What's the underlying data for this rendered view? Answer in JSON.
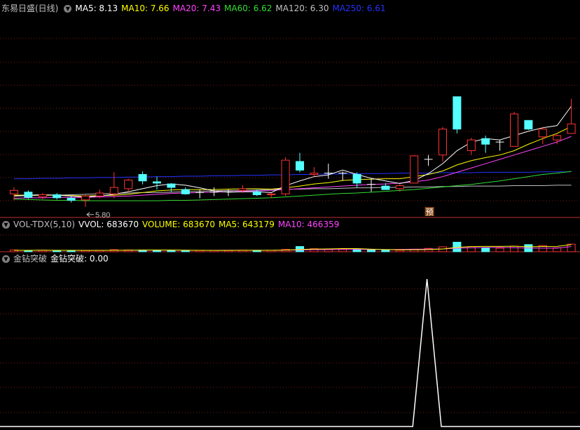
{
  "main_header": {
    "title": "东易日盛(日线)",
    "items": [
      {
        "label": "MA5: 8.13",
        "color": "#ffffff"
      },
      {
        "label": "MA10: 7.66",
        "color": "#ffff00"
      },
      {
        "label": "MA20: 7.43",
        "color": "#ff44ff"
      },
      {
        "label": "MA60: 6.62",
        "color": "#33dd33"
      },
      {
        "label": "MA120: 6.30",
        "color": "#c0c0c0"
      },
      {
        "label": "MA250: 6.61",
        "color": "#2233ff"
      }
    ]
  },
  "vol_header": {
    "title": "VOL-TDX(5,10)",
    "items": [
      {
        "label": "VVOL: 683670",
        "color": "#ffffff"
      },
      {
        "label": "VOLUME: 683670",
        "color": "#ffff00"
      },
      {
        "label": "MA5: 643179",
        "color": "#ffff00"
      },
      {
        "label": "MA10: 466359",
        "color": "#ff44ff"
      }
    ]
  },
  "ind_header": {
    "title": "金钻突破",
    "items": [
      {
        "label": "金钻突破: 0.00",
        "color": "#ffffff"
      }
    ]
  },
  "annotations": {
    "low_marker": "5.80",
    "forecast_tag": "预"
  },
  "colors": {
    "up": "#ff3333",
    "down": "#54ffff",
    "grid": "#7a1a1a",
    "frame": "#c03030"
  },
  "chart_data": [
    {
      "type": "candlestick",
      "title": "东易日盛(日线)",
      "candles": [
        {
          "o": 6.1,
          "h": 6.25,
          "l": 5.95,
          "c": 6.18
        },
        {
          "o": 6.14,
          "h": 6.18,
          "l": 5.98,
          "c": 6.02
        },
        {
          "o": 6.03,
          "h": 6.12,
          "l": 5.98,
          "c": 6.08
        },
        {
          "o": 6.08,
          "h": 6.12,
          "l": 5.97,
          "c": 6.01
        },
        {
          "o": 6.0,
          "h": 6.04,
          "l": 5.9,
          "c": 5.95
        },
        {
          "o": 5.96,
          "h": 6.08,
          "l": 5.8,
          "c": 6.05
        },
        {
          "o": 6.05,
          "h": 6.2,
          "l": 6.0,
          "c": 6.12
        },
        {
          "o": 6.1,
          "h": 6.6,
          "l": 6.0,
          "c": 6.25
        },
        {
          "o": 6.22,
          "h": 6.45,
          "l": 6.15,
          "c": 6.42
        },
        {
          "o": 6.55,
          "h": 6.62,
          "l": 6.32,
          "c": 6.4
        },
        {
          "o": 6.38,
          "h": 6.5,
          "l": 6.2,
          "c": 6.35
        },
        {
          "o": 6.33,
          "h": 6.35,
          "l": 6.15,
          "c": 6.25
        },
        {
          "o": 6.2,
          "h": 6.25,
          "l": 6.08,
          "c": 6.1
        },
        {
          "o": 6.12,
          "h": 6.2,
          "l": 6.0,
          "c": 6.13
        },
        {
          "o": 6.14,
          "h": 6.25,
          "l": 6.05,
          "c": 6.14
        },
        {
          "o": 6.15,
          "h": 6.2,
          "l": 6.05,
          "c": 6.15
        },
        {
          "o": 6.18,
          "h": 6.3,
          "l": 6.12,
          "c": 6.22
        },
        {
          "o": 6.15,
          "h": 6.2,
          "l": 6.05,
          "c": 6.08
        },
        {
          "o": 6.08,
          "h": 6.12,
          "l": 6.0,
          "c": 6.1
        },
        {
          "o": 6.1,
          "h": 6.95,
          "l": 6.05,
          "c": 6.88
        },
        {
          "o": 6.85,
          "h": 7.05,
          "l": 6.6,
          "c": 6.65
        },
        {
          "o": 6.55,
          "h": 6.72,
          "l": 6.5,
          "c": 6.58
        },
        {
          "o": 6.58,
          "h": 6.8,
          "l": 6.45,
          "c": 6.58
        },
        {
          "o": 6.58,
          "h": 6.62,
          "l": 6.4,
          "c": 6.58
        },
        {
          "o": 6.55,
          "h": 6.6,
          "l": 6.25,
          "c": 6.35
        },
        {
          "o": 6.33,
          "h": 6.45,
          "l": 6.15,
          "c": 6.32
        },
        {
          "o": 6.28,
          "h": 6.35,
          "l": 6.2,
          "c": 6.2
        },
        {
          "o": 6.22,
          "h": 6.32,
          "l": 6.15,
          "c": 6.29
        },
        {
          "o": 6.35,
          "h": 7.0,
          "l": 6.35,
          "c": 6.98
        },
        {
          "o": 6.9,
          "h": 7.0,
          "l": 6.75,
          "c": 6.9
        },
        {
          "o": 7.0,
          "h": 7.65,
          "l": 6.85,
          "c": 7.6
        },
        {
          "o": 8.35,
          "h": 8.35,
          "l": 7.5,
          "c": 7.6
        },
        {
          "o": 7.1,
          "h": 7.4,
          "l": 7.0,
          "c": 7.35
        },
        {
          "o": 7.38,
          "h": 7.45,
          "l": 7.05,
          "c": 7.25
        },
        {
          "o": 7.3,
          "h": 7.35,
          "l": 7.1,
          "c": 7.3
        },
        {
          "o": 7.2,
          "h": 8.0,
          "l": 7.2,
          "c": 7.95
        },
        {
          "o": 7.8,
          "h": 7.8,
          "l": 7.58,
          "c": 7.6
        },
        {
          "o": 7.42,
          "h": 7.65,
          "l": 7.25,
          "c": 7.6
        },
        {
          "o": 7.35,
          "h": 7.48,
          "l": 7.25,
          "c": 7.45
        },
        {
          "o": 7.5,
          "h": 8.3,
          "l": 7.5,
          "c": 7.72
        }
      ],
      "ma": {
        "MA5": [
          6.05,
          6.07,
          6.08,
          6.07,
          6.05,
          6.03,
          6.05,
          6.09,
          6.15,
          6.22,
          6.29,
          6.33,
          6.3,
          6.24,
          6.17,
          6.14,
          6.15,
          6.15,
          6.13,
          6.29,
          6.4,
          6.5,
          6.54,
          6.65,
          6.55,
          6.46,
          6.4,
          6.34,
          6.41,
          6.57,
          6.8,
          7.1,
          7.3,
          7.38,
          7.35,
          7.45,
          7.55,
          7.63,
          7.68,
          8.13
        ],
        "MA10": [
          6.07,
          6.07,
          6.07,
          6.07,
          6.06,
          6.05,
          6.06,
          6.07,
          6.09,
          6.13,
          6.17,
          6.19,
          6.2,
          6.2,
          6.2,
          6.21,
          6.22,
          6.22,
          6.21,
          6.24,
          6.28,
          6.33,
          6.36,
          6.41,
          6.43,
          6.44,
          6.45,
          6.45,
          6.5,
          6.55,
          6.63,
          6.77,
          6.87,
          6.94,
          7.0,
          7.1,
          7.25,
          7.38,
          7.5,
          7.66
        ],
        "MA20": [
          6.0,
          6.01,
          6.01,
          6.02,
          6.02,
          6.02,
          6.03,
          6.04,
          6.05,
          6.07,
          6.09,
          6.11,
          6.12,
          6.13,
          6.14,
          6.15,
          6.16,
          6.17,
          6.18,
          6.2,
          6.22,
          6.24,
          6.26,
          6.28,
          6.3,
          6.32,
          6.33,
          6.35,
          6.38,
          6.42,
          6.5,
          6.6,
          6.7,
          6.8,
          6.9,
          7.0,
          7.1,
          7.2,
          7.3,
          7.43
        ],
        "MA60": [
          5.98,
          5.97,
          5.96,
          5.95,
          5.95,
          5.94,
          5.94,
          5.94,
          5.94,
          5.94,
          5.94,
          5.95,
          5.95,
          5.96,
          5.97,
          5.98,
          5.99,
          6.0,
          6.01,
          6.03,
          6.05,
          6.07,
          6.09,
          6.11,
          6.12,
          6.14,
          6.16,
          6.18,
          6.2,
          6.23,
          6.26,
          6.29,
          6.32,
          6.36,
          6.4,
          6.45,
          6.5,
          6.55,
          6.58,
          6.62
        ],
        "MA120": [
          6.05,
          6.06,
          6.07,
          6.07,
          6.08,
          6.09,
          6.1,
          6.11,
          6.12,
          6.13,
          6.13,
          6.14,
          6.15,
          6.16,
          6.17,
          6.18,
          6.18,
          6.19,
          6.2,
          6.21,
          6.21,
          6.22,
          6.22,
          6.23,
          6.24,
          6.24,
          6.25,
          6.25,
          6.26,
          6.26,
          6.27,
          6.27,
          6.28,
          6.28,
          6.28,
          6.29,
          6.29,
          6.29,
          6.3,
          6.3
        ],
        "MA250": [
          6.45,
          6.45,
          6.46,
          6.46,
          6.47,
          6.47,
          6.48,
          6.48,
          6.49,
          6.49,
          6.5,
          6.5,
          6.51,
          6.51,
          6.52,
          6.52,
          6.53,
          6.53,
          6.54,
          6.54,
          6.55,
          6.55,
          6.56,
          6.56,
          6.57,
          6.57,
          6.57,
          6.58,
          6.58,
          6.58,
          6.59,
          6.59,
          6.59,
          6.6,
          6.6,
          6.6,
          6.6,
          6.61,
          6.61,
          6.61
        ]
      },
      "ylim": [
        5.7,
        10.2
      ]
    },
    {
      "type": "bar",
      "title": "VOL-TDX(5,10)",
      "volume": [
        155000,
        120000,
        135000,
        110000,
        100000,
        115000,
        130000,
        185000,
        160000,
        150000,
        140000,
        115000,
        105000,
        115000,
        125000,
        120000,
        135000,
        130000,
        125000,
        210000,
        470000,
        270000,
        235000,
        225000,
        215000,
        160000,
        130000,
        140000,
        225000,
        300000,
        445000,
        860000,
        470000,
        330000,
        325000,
        500000,
        645000,
        560000,
        355000,
        683670
      ],
      "ma5": [
        130000,
        130000,
        132000,
        130000,
        124000,
        116000,
        118000,
        128000,
        138000,
        148000,
        153000,
        150000,
        134000,
        127000,
        120000,
        120000,
        123000,
        125000,
        126000,
        144000,
        204000,
        239000,
        252000,
        286000,
        283000,
        231000,
        193000,
        173000,
        175000,
        191000,
        249000,
        396000,
        464000,
        481000,
        486000,
        497000,
        454000,
        472000,
        481000,
        643179
      ],
      "ma10": [
        130000,
        130000,
        131000,
        130000,
        127000,
        123000,
        124000,
        129000,
        133000,
        136000,
        140000,
        139000,
        131000,
        128000,
        126000,
        131000,
        138000,
        137000,
        133000,
        140000,
        161000,
        180000,
        189000,
        204000,
        205000,
        201000,
        198000,
        206000,
        229000,
        237000,
        250000,
        317000,
        358000,
        383000,
        385000,
        364000,
        324000,
        323000,
        328000,
        466359
      ],
      "ylim": [
        0,
        1900000
      ]
    },
    {
      "type": "line",
      "title": "金钻突破",
      "x_index": [
        0,
        1,
        2,
        3,
        4,
        5,
        6,
        7,
        8,
        9,
        10,
        11,
        12,
        13,
        14,
        15,
        16,
        17,
        18,
        19,
        20,
        21,
        22,
        23,
        24,
        25,
        26,
        27,
        28,
        29,
        30,
        31,
        32,
        33,
        34,
        35,
        36,
        37,
        38,
        39
      ],
      "values": [
        0,
        0,
        0,
        0,
        0,
        0,
        0,
        0,
        0,
        0,
        0,
        0,
        0,
        0,
        0,
        0,
        0,
        0,
        0,
        0,
        0,
        0,
        0,
        0,
        0,
        0,
        0,
        0,
        0,
        1,
        0,
        0,
        0,
        0,
        0,
        0,
        0,
        0,
        0,
        0
      ],
      "ylim": [
        0,
        1.1
      ]
    }
  ]
}
